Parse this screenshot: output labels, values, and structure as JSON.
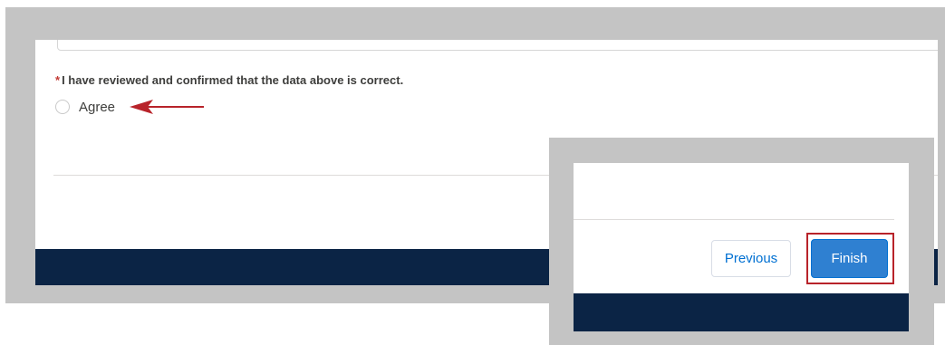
{
  "form": {
    "required_marker": "*",
    "confirmation_question": "I have reviewed and confirmed that the data above is correct.",
    "agree_option": {
      "label": "Agree",
      "selected": false
    }
  },
  "footer": {
    "previous_label": "Previous",
    "finish_label": "Finish"
  },
  "colors": {
    "footer_bar": "#0b2445",
    "primary_button": "#2f80d1",
    "link_text": "#0070d2",
    "annotation_red": "#b8232a",
    "required_red": "#c23934"
  },
  "icons": {
    "annotation_arrow": "arrow-left-icon",
    "annotation_box": "highlight-box"
  }
}
